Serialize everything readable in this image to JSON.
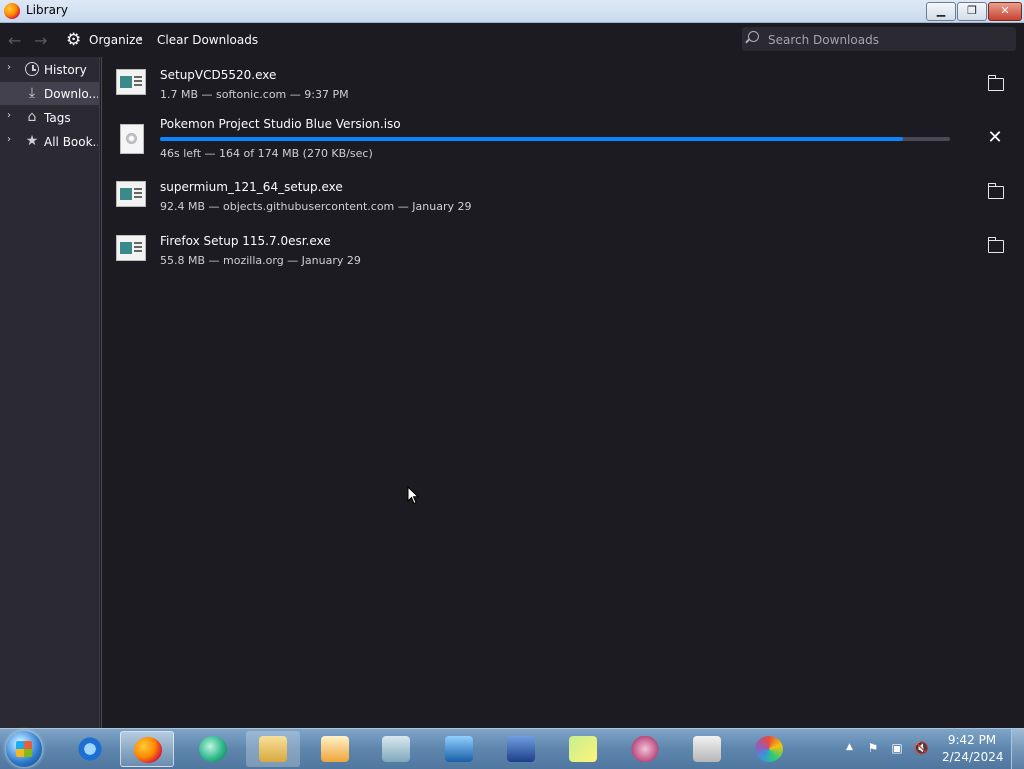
{
  "window": {
    "title": "Library"
  },
  "toolbar": {
    "organize_label": "Organize",
    "clear_label": "Clear Downloads",
    "search_placeholder": "Search Downloads"
  },
  "sidebar": {
    "items": [
      {
        "label": "History",
        "icon": "clock-icon",
        "expandable": true,
        "selected": false
      },
      {
        "label": "Downlo...",
        "icon": "download-icon",
        "expandable": false,
        "selected": true
      },
      {
        "label": "Tags",
        "icon": "tag-icon",
        "expandable": true,
        "selected": false
      },
      {
        "label": "All Book...",
        "icon": "star-icon",
        "expandable": true,
        "selected": false
      }
    ]
  },
  "downloads": [
    {
      "name": "SetupVCD5520.exe",
      "status": "1.7 MB — softonic.com — 9:37 PM",
      "icon": "exe-file-icon",
      "action": "folder-icon"
    },
    {
      "name": "Pokemon Project Studio Blue Version.iso",
      "status": "46s left — 164 of 174 MB (270 KB/sec)",
      "icon": "iso-file-icon",
      "action": "cancel-icon",
      "progress_percent": 94
    },
    {
      "name": "supermium_121_64_setup.exe",
      "status": "92.4 MB — objects.githubusercontent.com — January 29",
      "icon": "exe-file-icon",
      "action": "folder-icon"
    },
    {
      "name": "Firefox Setup 115.7.0esr.exe",
      "status": "55.8 MB — mozilla.org — January 29",
      "icon": "exe-file-icon",
      "action": "folder-icon"
    }
  ],
  "taskbar": {
    "apps": [
      "internet-explorer",
      "firefox",
      "chat-app",
      "file-explorer",
      "media-player",
      "document-app",
      "remote-desktop",
      "network-app",
      "sticky-notes",
      "snipping-tool",
      "calculator",
      "paint"
    ],
    "active_app": "firefox",
    "time": "9:42 PM",
    "date": "2/24/2024"
  },
  "colors": {
    "accent": "#0a84ff",
    "background": "#1c1b22",
    "sidebar": "#2b2a33"
  }
}
